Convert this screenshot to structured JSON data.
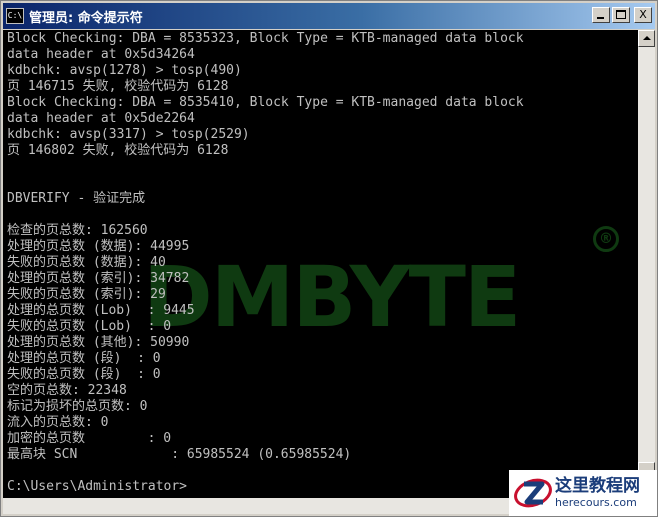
{
  "window": {
    "icon_text": "C:\\",
    "title": "管理员: 命令提示符",
    "minimize_label": "",
    "maximize_label": "",
    "close_label": "X"
  },
  "console": {
    "lines": [
      "Block Checking: DBA = 8535323, Block Type = KTB-managed data block",
      "data header at 0x5d34264",
      "kdbchk: avsp(1278) > tosp(490)",
      "页 146715 失败, 校验代码为 6128",
      "Block Checking: DBA = 8535410, Block Type = KTB-managed data block",
      "data header at 0x5de2264",
      "kdbchk: avsp(3317) > tosp(2529)",
      "页 146802 失败, 校验代码为 6128",
      "",
      "",
      "DBVERIFY - 验证完成",
      "",
      "检查的页总数: 162560",
      "处理的页总数 (数据): 44995",
      "失败的页总数 (数据): 40",
      "处理的页总数 (索引): 34782",
      "失败的页总数 (索引): 29",
      "处理的总页数 (Lob)  : 9445",
      "失败的总页数 (Lob)  : 0",
      "处理的页总数 (其他): 50990",
      "处理的总页数 (段)  : 0",
      "失败的总页数 (段)  : 0",
      "空的页总数: 22348",
      "标记为损坏的总页数: 0",
      "流入的页总数: 0",
      "加密的总页数        : 0",
      "最高块 SCN            : 65985524 (0.65985524)",
      "",
      "C:\\Users\\Administrator>"
    ]
  },
  "watermark": {
    "text": "DMBYTE",
    "mark": "®"
  },
  "site_logo": {
    "name_cn": "这里教程网",
    "url": "herecours.com"
  },
  "colors": {
    "console_bg": "#000000",
    "console_fg": "#c0c0c0",
    "title_active": "#0a246a",
    "watermark": "#1c6a1f",
    "logo_blue": "#1b3d7a",
    "logo_red": "#c8102e"
  }
}
